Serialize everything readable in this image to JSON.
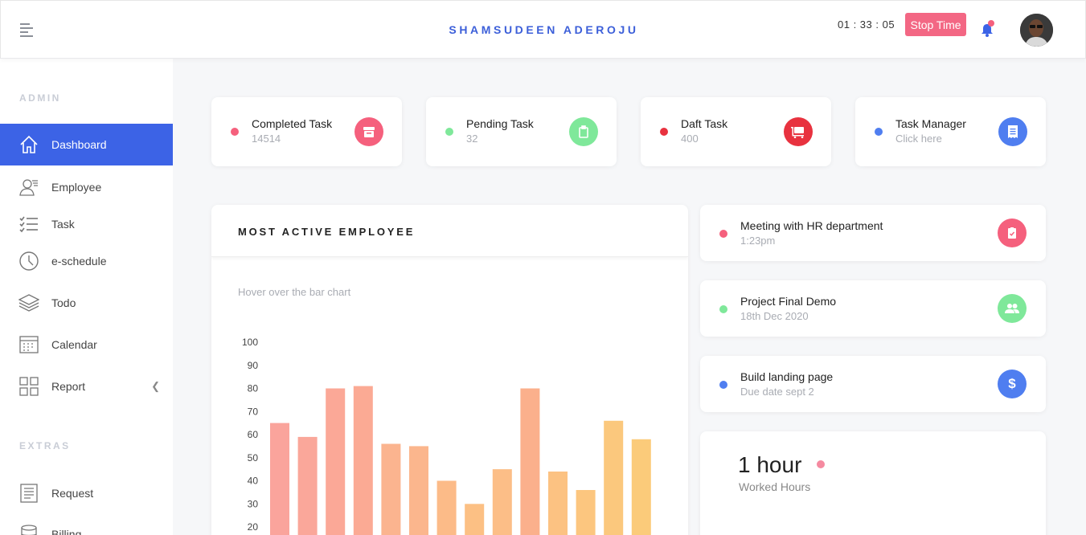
{
  "header": {
    "brand": "SHAMSUDEEN ADEROJU",
    "timer": "01 : 33 : 05",
    "stop_label": "Stop Time"
  },
  "sidebar": {
    "section_admin": "ADMIN",
    "section_extras": "EXTRAS",
    "items": [
      {
        "label": "Dashboard",
        "icon": "home-icon"
      },
      {
        "label": "Employee",
        "icon": "employee-icon"
      },
      {
        "label": "Task",
        "icon": "task-list-icon"
      },
      {
        "label": "e-schedule",
        "icon": "clock-icon"
      },
      {
        "label": "Todo",
        "icon": "layers-icon"
      },
      {
        "label": "Calendar",
        "icon": "calendar-icon"
      },
      {
        "label": "Report",
        "icon": "grid-icon"
      },
      {
        "label": "Request",
        "icon": "document-icon"
      },
      {
        "label": "Billing",
        "icon": "database-icon"
      }
    ]
  },
  "stats": [
    {
      "title": "Completed Task",
      "value": "14514",
      "dot_color": "#f5607d",
      "icon_color": "#f5607d",
      "icon": "archive-icon"
    },
    {
      "title": "Pending Task",
      "value": "32",
      "dot_color": "#7fe89a",
      "icon_color": "#7fe89a",
      "icon": "clipboard-icon"
    },
    {
      "title": "Daft Task",
      "value": "400",
      "dot_color": "#e8323f",
      "icon_color": "#e8323f",
      "icon": "cart-icon"
    },
    {
      "title": "Task Manager",
      "value": "Click here",
      "dot_color": "#4f7ef0",
      "icon_color": "#4f7ef0",
      "icon": "receipt-icon"
    }
  ],
  "chart_panel": {
    "title": "MOST ACTIVE EMPLOYEE",
    "hint": "Hover over the bar chart"
  },
  "events": [
    {
      "title": "Meeting with HR department",
      "sub": "1:23pm",
      "dot_color": "#f5607d",
      "icon_color": "#f5607d",
      "icon": "clipboard-check-icon"
    },
    {
      "title": "Project Final Demo",
      "sub": "18th Dec 2020",
      "dot_color": "#7fe89a",
      "icon_color": "#7fe89a",
      "icon": "users-icon"
    },
    {
      "title": "Build landing page",
      "sub": "Due date sept 2",
      "dot_color": "#4f7ef0",
      "icon_color": "#4f7ef0",
      "icon": "dollar-icon"
    }
  ],
  "hours": {
    "value": "1 hour",
    "label": "Worked Hours"
  },
  "chart_data": {
    "type": "bar",
    "title": "",
    "xlabel": "",
    "ylabel": "",
    "ylim": [
      20,
      100
    ],
    "yticks": [
      100,
      90,
      80,
      70,
      60,
      50,
      40,
      30,
      20
    ],
    "values": [
      65,
      59,
      80,
      81,
      56,
      55,
      40,
      30,
      45,
      80,
      44,
      36,
      66,
      58
    ],
    "colors": [
      "#faa49c",
      "#faa79a",
      "#fba897",
      "#fbaa94",
      "#fbb48f",
      "#fbb68d",
      "#fcbb88",
      "#fcc084",
      "#fcbe87",
      "#fbb08c",
      "#fcc282",
      "#fcc67f",
      "#fbc87d",
      "#fbcb7a"
    ]
  }
}
